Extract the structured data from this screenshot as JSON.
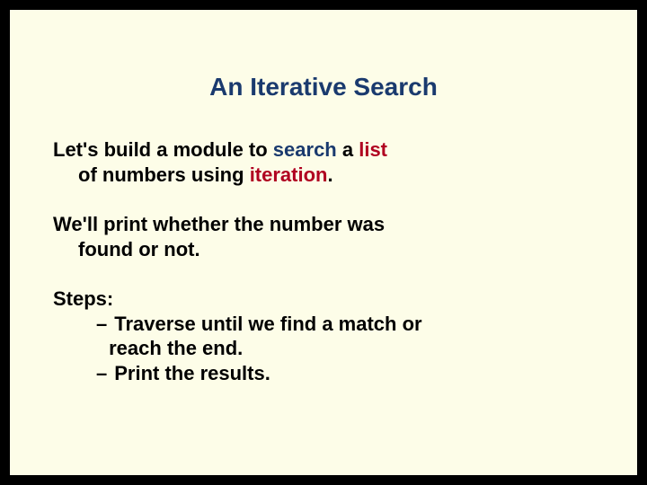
{
  "title": "An Iterative Search",
  "p1": {
    "pre": "Let's build a module to ",
    "kw_search": "search",
    "mid": " a ",
    "kw_list": "list",
    "line2_pre": "of numbers using ",
    "kw_iteration": "iteration",
    "line2_post": "."
  },
  "p2": {
    "line1": "We'll print whether the number was",
    "line2": "found or not."
  },
  "steps": {
    "label": "Steps:",
    "dash": "–",
    "b1_l1": "Traverse until we find a match or",
    "b1_l2": "reach the end.",
    "b2": "Print the results."
  }
}
